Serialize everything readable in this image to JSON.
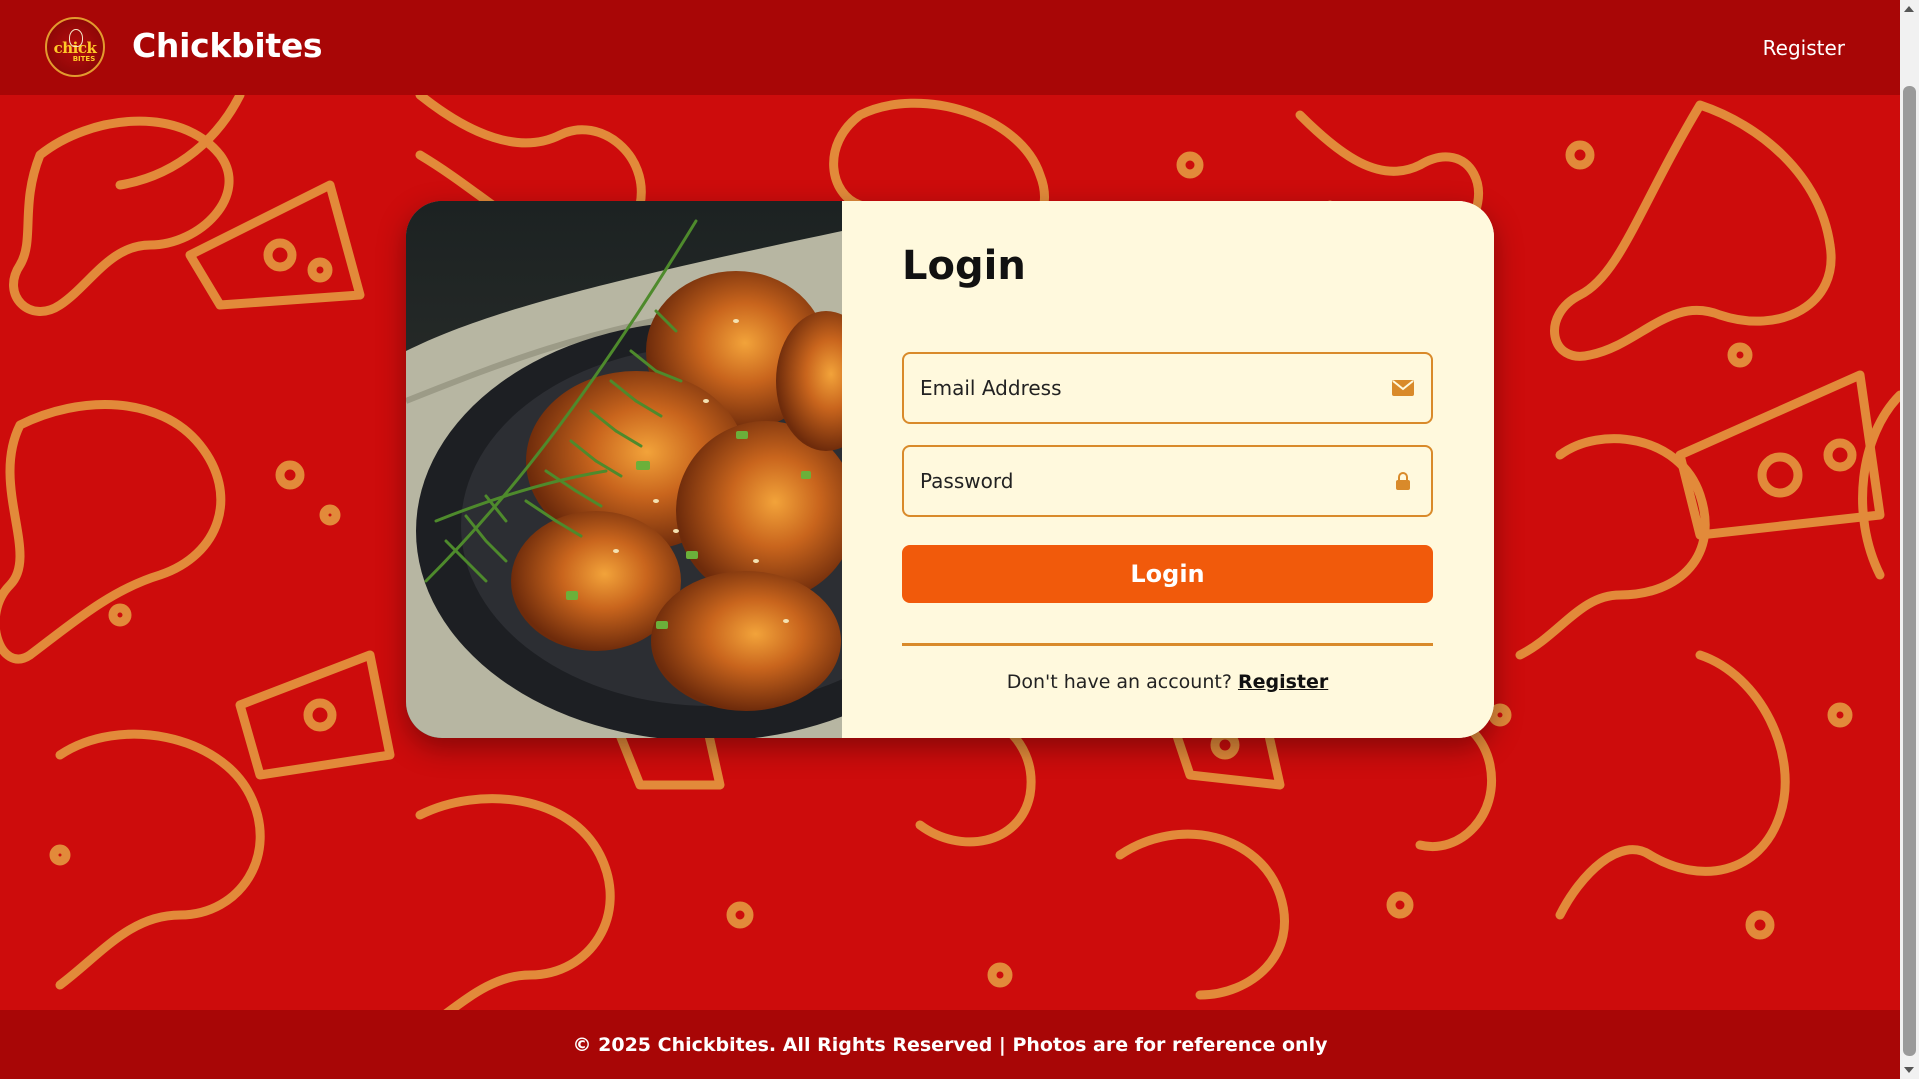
{
  "header": {
    "logo_text_top": "chick",
    "logo_text_bottom": "BITES",
    "brand": "Chickbites",
    "nav_register": "Register"
  },
  "login": {
    "title": "Login",
    "email_placeholder": "Email Address",
    "password_placeholder": "Password",
    "submit_label": "Login",
    "signup_prompt": "Don't have an account?",
    "signup_link": "Register",
    "icons": [
      "mail-icon",
      "lock-icon"
    ]
  },
  "footer": {
    "text": "© 2025 Chickbites. All Rights Reserved | Photos are for reference only"
  },
  "colors": {
    "header_bg": "#a80606",
    "page_bg": "#cd0c0c",
    "pattern": "#e28a3a",
    "card_bg": "#fff9dd",
    "field_border": "#d98a2a",
    "button": "#f15a0b"
  }
}
